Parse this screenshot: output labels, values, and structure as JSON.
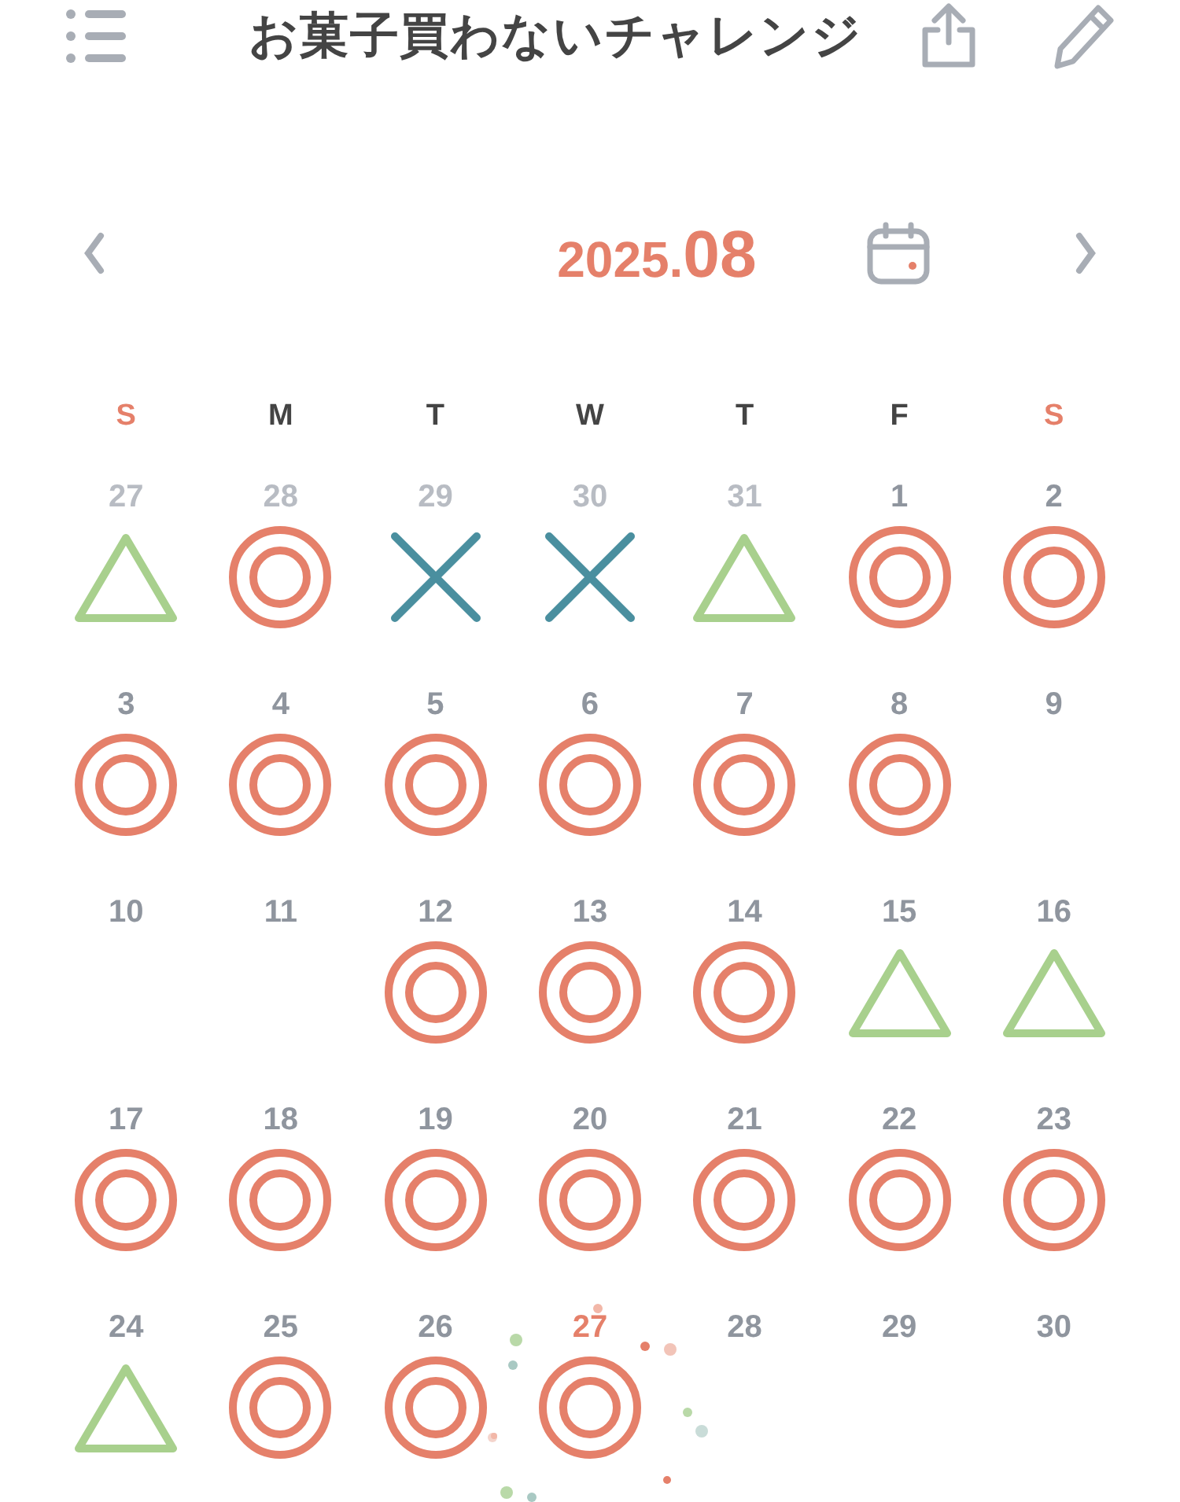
{
  "header": {
    "title": "お菓子買わないチャレンジ"
  },
  "month_nav": {
    "year": "2025.",
    "month": "08"
  },
  "weekdays": [
    {
      "label": "S",
      "weekend": true
    },
    {
      "label": "M",
      "weekend": false
    },
    {
      "label": "T",
      "weekend": false
    },
    {
      "label": "W",
      "weekend": false
    },
    {
      "label": "T",
      "weekend": false
    },
    {
      "label": "F",
      "weekend": false
    },
    {
      "label": "S",
      "weekend": true
    }
  ],
  "days": [
    {
      "number": "27",
      "muted": true,
      "today": false,
      "kind": "triangle"
    },
    {
      "number": "28",
      "muted": true,
      "today": false,
      "kind": "double-circle"
    },
    {
      "number": "29",
      "muted": true,
      "today": false,
      "kind": "cross"
    },
    {
      "number": "30",
      "muted": true,
      "today": false,
      "kind": "cross"
    },
    {
      "number": "31",
      "muted": true,
      "today": false,
      "kind": "triangle"
    },
    {
      "number": "1",
      "muted": false,
      "today": false,
      "kind": "double-circle"
    },
    {
      "number": "2",
      "muted": false,
      "today": false,
      "kind": "double-circle"
    },
    {
      "number": "3",
      "muted": false,
      "today": false,
      "kind": "double-circle"
    },
    {
      "number": "4",
      "muted": false,
      "today": false,
      "kind": "double-circle"
    },
    {
      "number": "5",
      "muted": false,
      "today": false,
      "kind": "double-circle"
    },
    {
      "number": "6",
      "muted": false,
      "today": false,
      "kind": "double-circle"
    },
    {
      "number": "7",
      "muted": false,
      "today": false,
      "kind": "double-circle"
    },
    {
      "number": "8",
      "muted": false,
      "today": false,
      "kind": "double-circle"
    },
    {
      "number": "9",
      "muted": false,
      "today": false,
      "kind": "empty"
    },
    {
      "number": "10",
      "muted": false,
      "today": false,
      "kind": "empty"
    },
    {
      "number": "11",
      "muted": false,
      "today": false,
      "kind": "empty"
    },
    {
      "number": "12",
      "muted": false,
      "today": false,
      "kind": "double-circle"
    },
    {
      "number": "13",
      "muted": false,
      "today": false,
      "kind": "double-circle"
    },
    {
      "number": "14",
      "muted": false,
      "today": false,
      "kind": "double-circle"
    },
    {
      "number": "15",
      "muted": false,
      "today": false,
      "kind": "triangle"
    },
    {
      "number": "16",
      "muted": false,
      "today": false,
      "kind": "triangle"
    },
    {
      "number": "17",
      "muted": false,
      "today": false,
      "kind": "double-circle"
    },
    {
      "number": "18",
      "muted": false,
      "today": false,
      "kind": "double-circle"
    },
    {
      "number": "19",
      "muted": false,
      "today": false,
      "kind": "double-circle"
    },
    {
      "number": "20",
      "muted": false,
      "today": false,
      "kind": "double-circle"
    },
    {
      "number": "21",
      "muted": false,
      "today": false,
      "kind": "double-circle"
    },
    {
      "number": "22",
      "muted": false,
      "today": false,
      "kind": "double-circle"
    },
    {
      "number": "23",
      "muted": false,
      "today": false,
      "kind": "double-circle"
    },
    {
      "number": "24",
      "muted": false,
      "today": false,
      "kind": "triangle"
    },
    {
      "number": "25",
      "muted": false,
      "today": false,
      "kind": "double-circle"
    },
    {
      "number": "26",
      "muted": false,
      "today": false,
      "kind": "double-circle"
    },
    {
      "number": "27",
      "muted": false,
      "today": true,
      "kind": "double-circle"
    },
    {
      "number": "28",
      "muted": false,
      "today": false,
      "kind": "empty"
    },
    {
      "number": "29",
      "muted": false,
      "today": false,
      "kind": "empty"
    },
    {
      "number": "30",
      "muted": false,
      "today": false,
      "kind": "empty"
    }
  ]
}
